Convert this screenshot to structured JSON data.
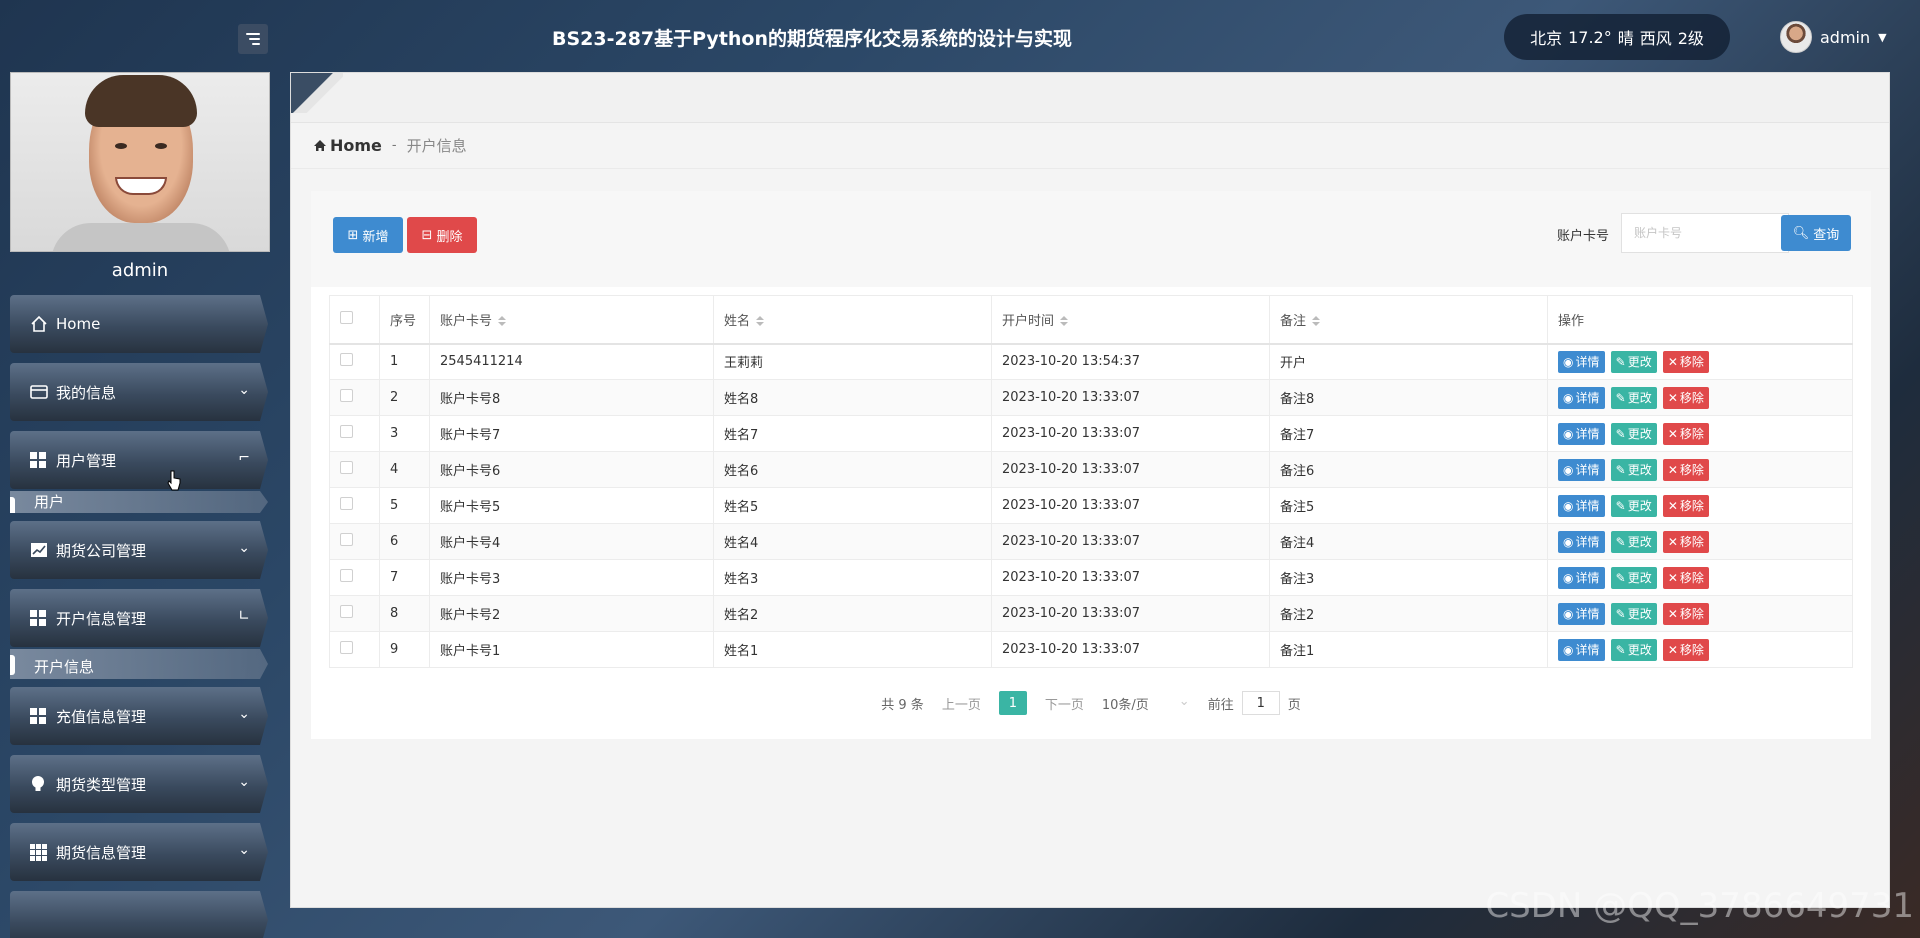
{
  "header": {
    "title": "BS23-287基于Python的期货程序化交易系统的设计与实现",
    "weather": {
      "city": "北京",
      "temp": "17.2°",
      "cond": "晴",
      "wind": "西风",
      "level": "2级"
    },
    "user": "admin"
  },
  "sidebar": {
    "profile_name": "admin",
    "items": [
      {
        "label": "Home",
        "icon": "home-icon"
      },
      {
        "label": "我的信息",
        "icon": "card-icon"
      },
      {
        "label": "用户管理",
        "icon": "grid-icon"
      },
      {
        "sub": "用户"
      },
      {
        "label": "期货公司管理",
        "icon": "chart-icon"
      },
      {
        "label": "开户信息管理",
        "icon": "grid-icon"
      },
      {
        "sub": "开户信息"
      },
      {
        "label": "充值信息管理",
        "icon": "grid-icon"
      },
      {
        "label": "期货类型管理",
        "icon": "bulb-icon"
      },
      {
        "label": "期货信息管理",
        "icon": "grid9-icon"
      }
    ]
  },
  "breadcrumb": {
    "home": "Home",
    "sep": "-",
    "current": "开户信息"
  },
  "toolbar": {
    "add_label": "新增",
    "delete_label": "删除",
    "search_label": "账户卡号",
    "search_placeholder": "账户卡号",
    "search_button": "查询"
  },
  "table": {
    "headers": {
      "index": "序号",
      "card": "账户卡号",
      "name": "姓名",
      "time": "开户时间",
      "note": "备注",
      "ops": "操作"
    },
    "ops": {
      "detail": "详情",
      "edit": "更改",
      "remove": "移除"
    },
    "rows": [
      {
        "index": "1",
        "card": "2545411214",
        "name": "王莉莉",
        "time": "2023-10-20 13:54:37",
        "note": "开户"
      },
      {
        "index": "2",
        "card": "账户卡号8",
        "name": "姓名8",
        "time": "2023-10-20 13:33:07",
        "note": "备注8"
      },
      {
        "index": "3",
        "card": "账户卡号7",
        "name": "姓名7",
        "time": "2023-10-20 13:33:07",
        "note": "备注7"
      },
      {
        "index": "4",
        "card": "账户卡号6",
        "name": "姓名6",
        "time": "2023-10-20 13:33:07",
        "note": "备注6"
      },
      {
        "index": "5",
        "card": "账户卡号5",
        "name": "姓名5",
        "time": "2023-10-20 13:33:07",
        "note": "备注5"
      },
      {
        "index": "6",
        "card": "账户卡号4",
        "name": "姓名4",
        "time": "2023-10-20 13:33:07",
        "note": "备注4"
      },
      {
        "index": "7",
        "card": "账户卡号3",
        "name": "姓名3",
        "time": "2023-10-20 13:33:07",
        "note": "备注3"
      },
      {
        "index": "8",
        "card": "账户卡号2",
        "name": "姓名2",
        "time": "2023-10-20 13:33:07",
        "note": "备注2"
      },
      {
        "index": "9",
        "card": "账户卡号1",
        "name": "姓名1",
        "time": "2023-10-20 13:33:07",
        "note": "备注1"
      }
    ]
  },
  "pager": {
    "total": "共 9 条",
    "prev": "上一页",
    "page": "1",
    "next": "下一页",
    "size": "10条/页",
    "goto_label": "前往",
    "goto_value": "1",
    "goto_suffix": "页"
  },
  "watermark": "CSDN @QQ_3786649731",
  "colors": {
    "primary": "#3e8bd0",
    "danger": "#e0494a",
    "teal": "#3ab5a4"
  }
}
